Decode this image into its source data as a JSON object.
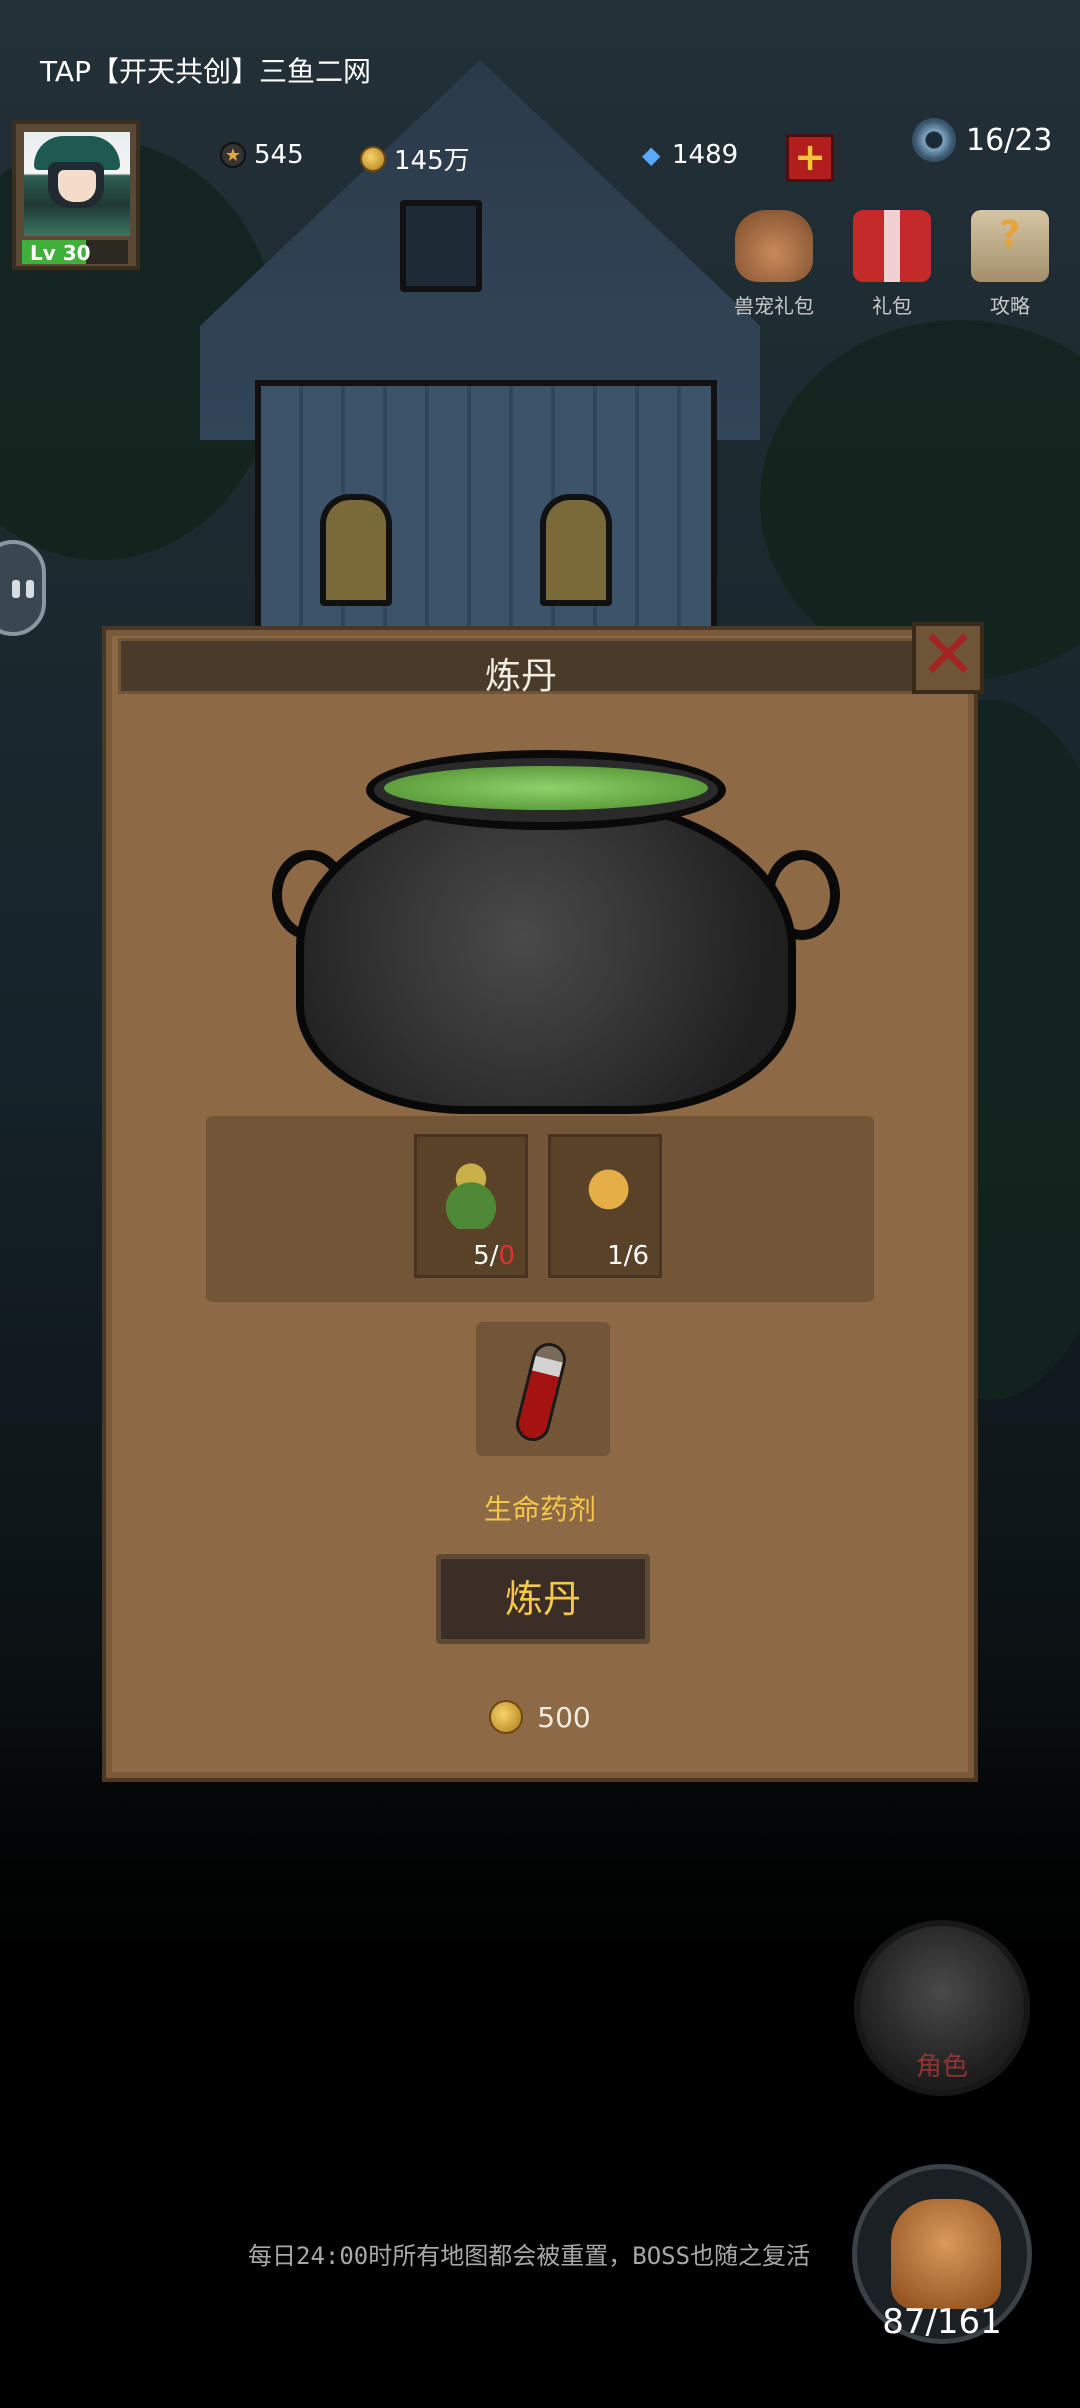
{
  "app_title": "TAP【开天共创】三鱼二网",
  "player": {
    "level_label": "Lv 30",
    "level_progress": 0.6
  },
  "resources": {
    "medals": "545",
    "gold": "145万",
    "diamonds": "1489",
    "stamina": "16/23"
  },
  "top_icons": [
    {
      "label": "兽宠礼包",
      "icon": "pet-gift-bag-icon"
    },
    {
      "label": "礼包",
      "icon": "gift-box-icon"
    },
    {
      "label": "攻略",
      "icon": "guide-book-icon"
    }
  ],
  "dialog": {
    "title": "炼丹",
    "ingredients": [
      {
        "icon": "herb-icon",
        "have": "5",
        "sep": "/",
        "need": "0"
      },
      {
        "icon": "ginseng-icon",
        "count": "1/6"
      }
    ],
    "product_name": "生命药剂",
    "brew_label": "炼丹",
    "cost": "500"
  },
  "npc_label": "角色",
  "tip": "每日24:00时所有地图都会被重置，BOSS也随之复活",
  "bag_count": "87/161",
  "colors": {
    "accent_gold": "#f6c84a",
    "panel": "#8d6a45",
    "close_red": "#a42424",
    "count_red": "#e53030"
  }
}
